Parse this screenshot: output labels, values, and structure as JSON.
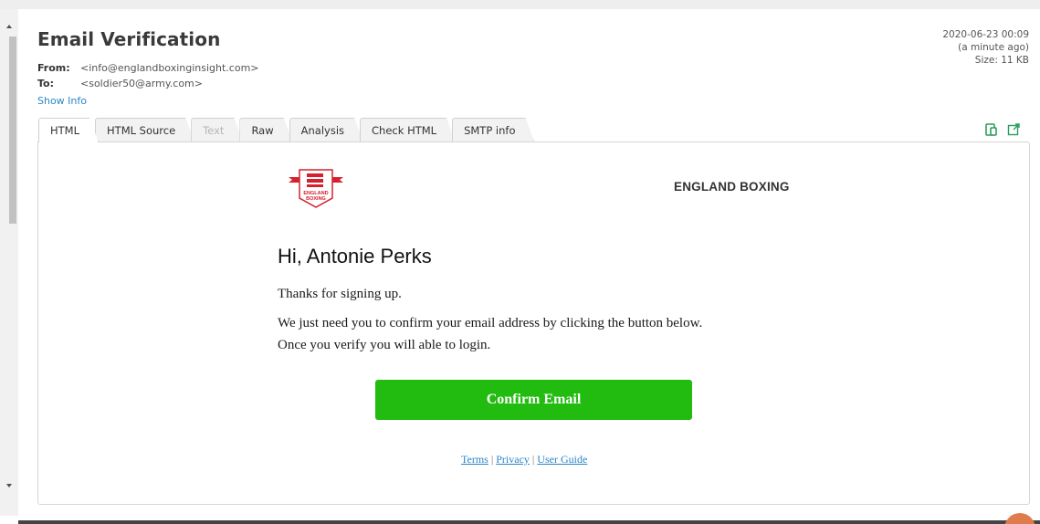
{
  "header": {
    "title": "Email Verification",
    "from_label": "From:",
    "from_value": "<info@englandboxinginsight.com>",
    "to_label": "To:",
    "to_value": "<soldier50@army.com>",
    "show_info": "Show Info",
    "date": "2020-06-23 00:09",
    "relative_time": "(a minute ago)",
    "size": "Size: 11 KB"
  },
  "tabs": [
    {
      "label": "HTML",
      "state": "active"
    },
    {
      "label": "HTML Source",
      "state": "normal"
    },
    {
      "label": "Text",
      "state": "disabled"
    },
    {
      "label": "Raw",
      "state": "normal"
    },
    {
      "label": "Analysis",
      "state": "normal"
    },
    {
      "label": "Check HTML",
      "state": "normal"
    },
    {
      "label": "SMTP info",
      "state": "normal"
    }
  ],
  "tab_icons": [
    "mobile-view-icon",
    "open-external-icon"
  ],
  "email_body": {
    "brand_name": "ENGLAND BOXING",
    "logo_text_line1": "ENGLAND",
    "logo_text_line2": "BOXING",
    "greeting": "Hi, Antonie Perks",
    "thanks": "Thanks for signing up.",
    "instruction_line1": "We just need you to confirm your email address by clicking the button below.",
    "instruction_line2": "Once you verify you will able to login.",
    "confirm_button": "Confirm Email",
    "footer": {
      "terms": "Terms",
      "privacy": "Privacy",
      "user_guide": "User Guide",
      "separator": "|"
    }
  },
  "colors": {
    "accent_green": "#22bb0f",
    "link_blue": "#2a86c6",
    "logo_red": "#d5202e"
  }
}
